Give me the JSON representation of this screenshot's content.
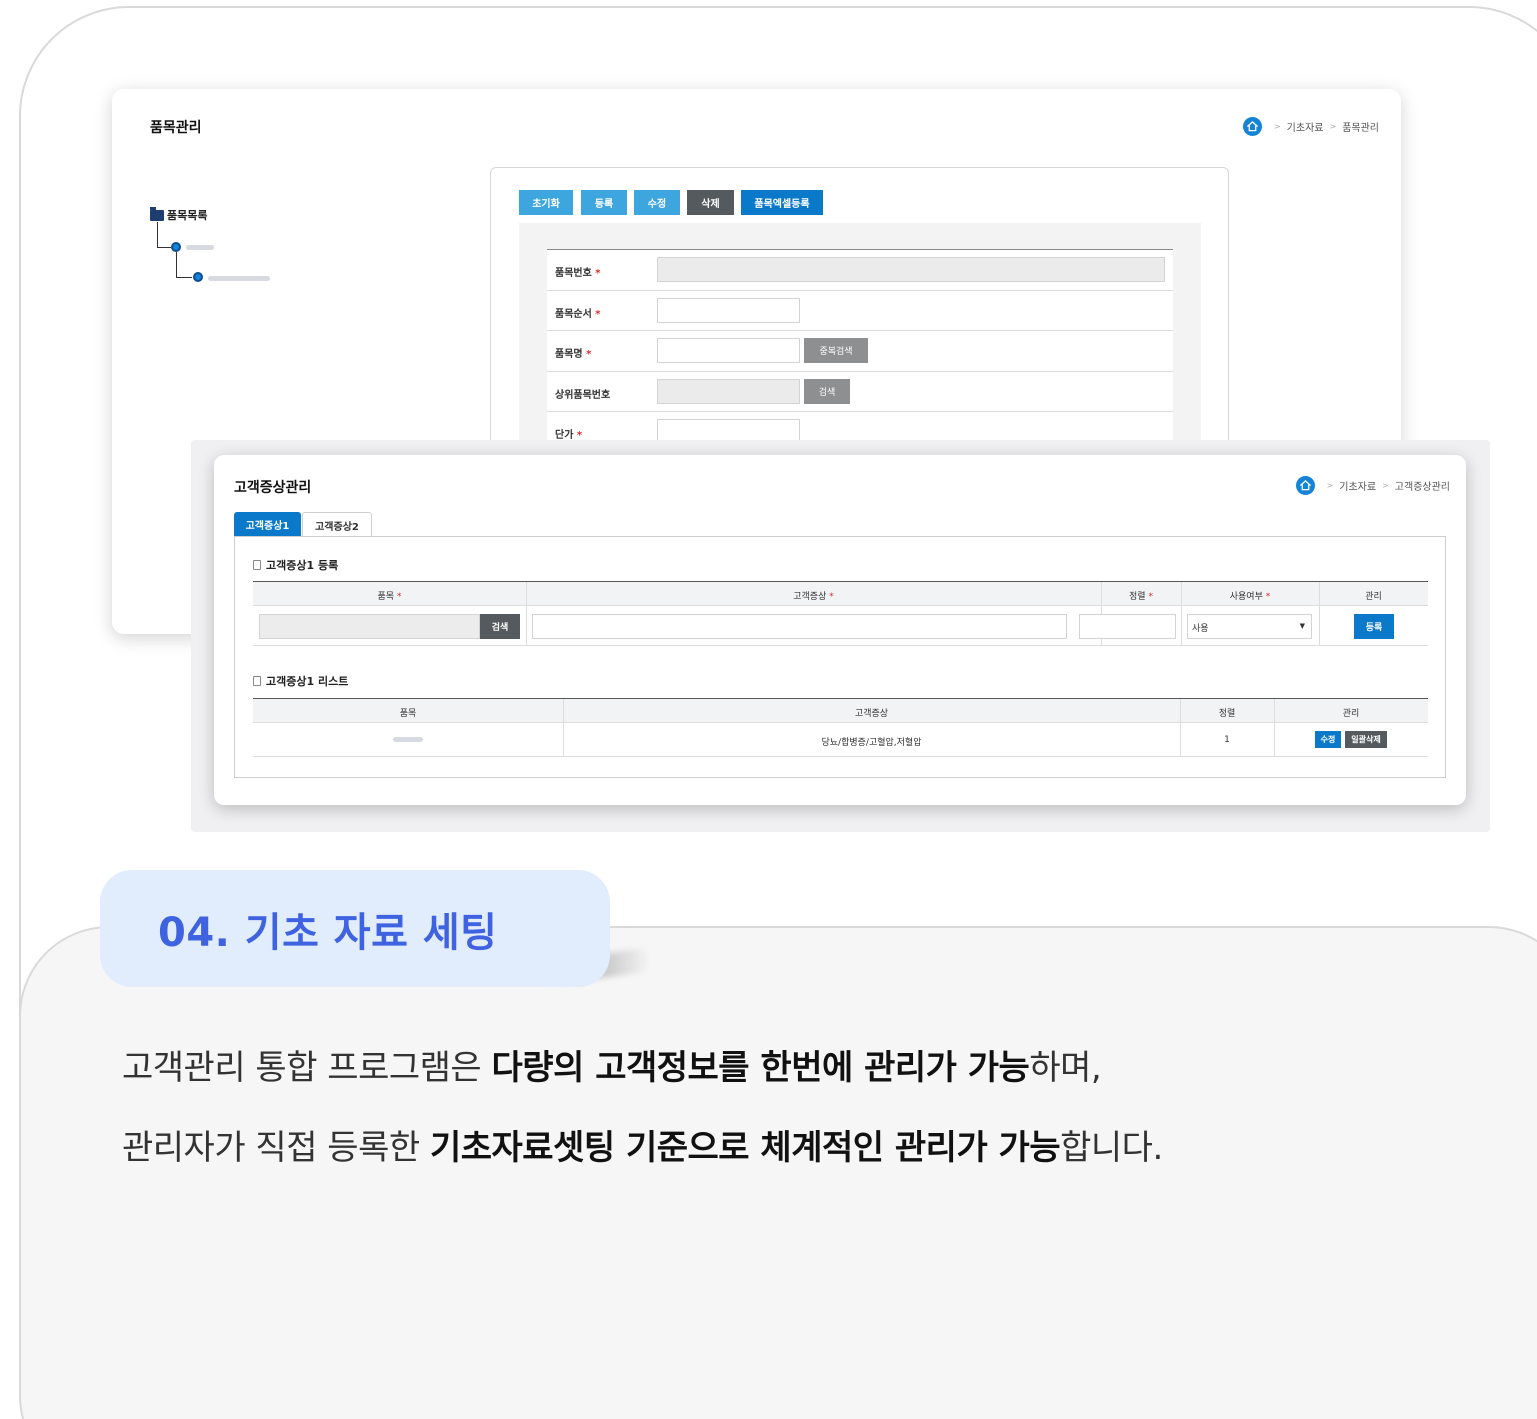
{
  "back_window": {
    "title": "품목관리",
    "breadcrumb": [
      "기초자료",
      "품목관리"
    ],
    "tree_root": "품목목록",
    "toolbar": [
      "초기화",
      "등록",
      "수정",
      "삭제",
      "품목엑셀등록"
    ],
    "fields": [
      {
        "label": "품목번호",
        "required": "*"
      },
      {
        "label": "품목순서",
        "required": "*"
      },
      {
        "label": "품목명",
        "required": "*",
        "button": "중복검색"
      },
      {
        "label": "상위품목번호",
        "required": "",
        "button": "검색"
      },
      {
        "label": "단가",
        "required": "*"
      }
    ]
  },
  "front_window": {
    "title": "고객증상관리",
    "breadcrumb": [
      "기초자료",
      "고객증상관리"
    ],
    "tabs": [
      "고객증상1",
      "고객증상2"
    ],
    "register_section": {
      "title": "고객증상1 등록",
      "headers": [
        "품목",
        "고객증상",
        "정렬",
        "사용여부",
        "관리"
      ],
      "required": "*",
      "search_button": "검색",
      "use_select_value": "사용",
      "select_arrow": "▼",
      "register_button": "등록"
    },
    "list_section": {
      "title": "고객증상1 리스트",
      "headers": [
        "품목",
        "고객증상",
        "정렬",
        "관리"
      ],
      "rows": [
        {
          "symptom": "당뇨/합병증/고혈압,저혈압",
          "order": "1",
          "edit": "수정",
          "delete": "일괄삭제"
        }
      ]
    }
  },
  "heading": "04. 기초 자료 세팅",
  "description": {
    "line1": {
      "pre": "고객관리 통합 프로그램은 ",
      "bold": "다량의 고객정보를 한번에 관리가 가능",
      "post": "하며,"
    },
    "line2": {
      "pre": "관리자가 직접 등록한 ",
      "bold": "기초자료셋팅 기준으로 체계적인 관리가 가능",
      "post": "합니다."
    }
  },
  "colors": {
    "accent": "#0b79c9",
    "heading_text": "#3f63e0",
    "heading_bg": "#e1edfd"
  }
}
